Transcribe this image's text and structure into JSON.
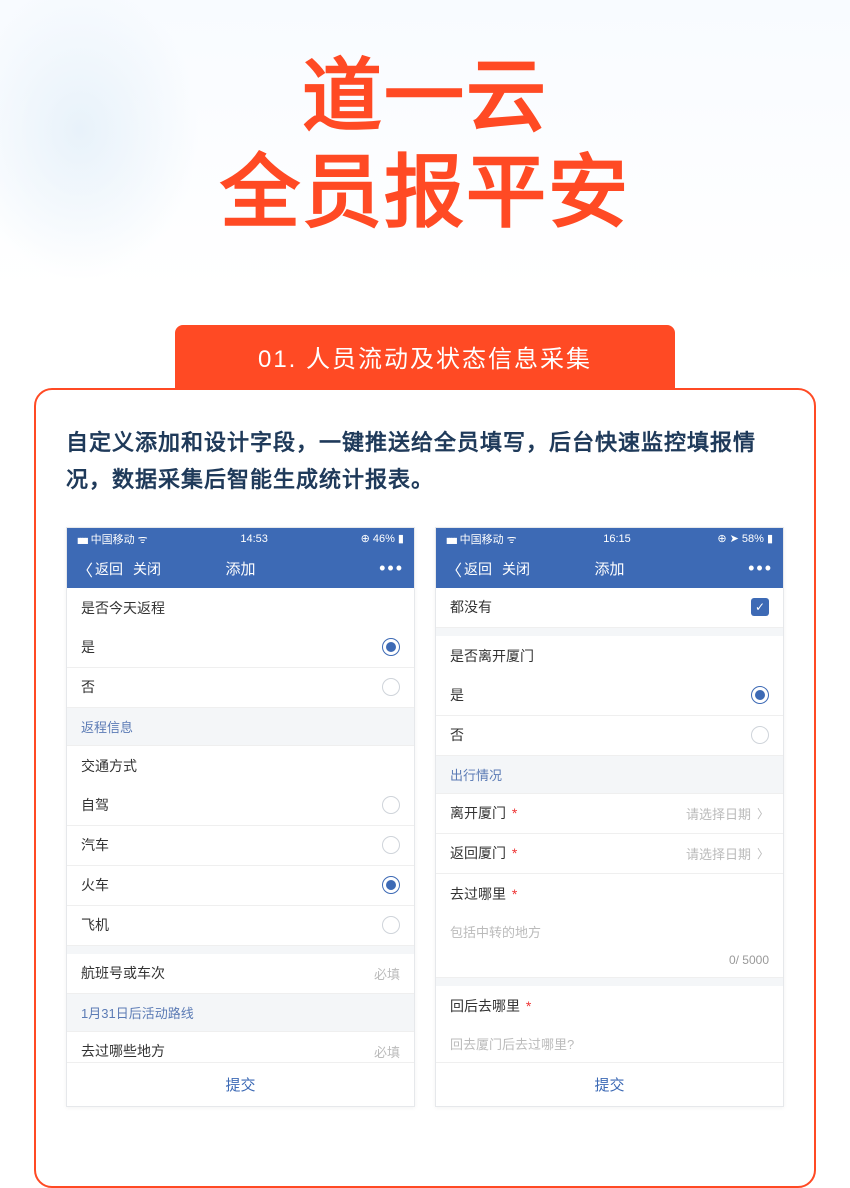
{
  "hero": {
    "line1": "道一云",
    "line2": "全员报平安"
  },
  "section": {
    "tab": "01. 人员流动及状态信息采集",
    "intro": "自定义添加和设计字段，一键推送给全员填写，后台快速监控填报情况，数据采集后智能生成统计报表。"
  },
  "phone_left": {
    "status": {
      "carrier": "中国移动",
      "time": "14:53",
      "battery": "46%"
    },
    "nav": {
      "back": "返回",
      "close": "关闭",
      "title": "添加",
      "more": "•••"
    },
    "q_return": "是否今天返程",
    "opt_yes": "是",
    "opt_no": "否",
    "section_return": "返程信息",
    "q_transport": "交通方式",
    "opts_transport": {
      "car": "自驾",
      "bus": "汽车",
      "train": "火车",
      "plane": "飞机"
    },
    "q_flight": "航班号或车次",
    "hint_required": "必填",
    "section_route": "1月31日后活动路线",
    "q_places": "去过哪些地方",
    "submit": "提交"
  },
  "phone_right": {
    "status": {
      "carrier": "中国移动",
      "time": "16:15",
      "battery": "58%"
    },
    "nav": {
      "back": "返回",
      "close": "关闭",
      "title": "添加",
      "more": "•••"
    },
    "top_option": "都没有",
    "q_leave": "是否离开厦门",
    "opt_yes": "是",
    "opt_no": "否",
    "section_travel": "出行情况",
    "q_leave_date": "离开厦门",
    "q_return_date": "返回厦门",
    "hint_date": "请选择日期",
    "q_where": "去过哪里",
    "ph_where": "包括中转的地方",
    "counter": "0/ 5000",
    "q_after": "回后去哪里",
    "ph_after": "回去厦门后去过哪里?",
    "submit": "提交"
  }
}
